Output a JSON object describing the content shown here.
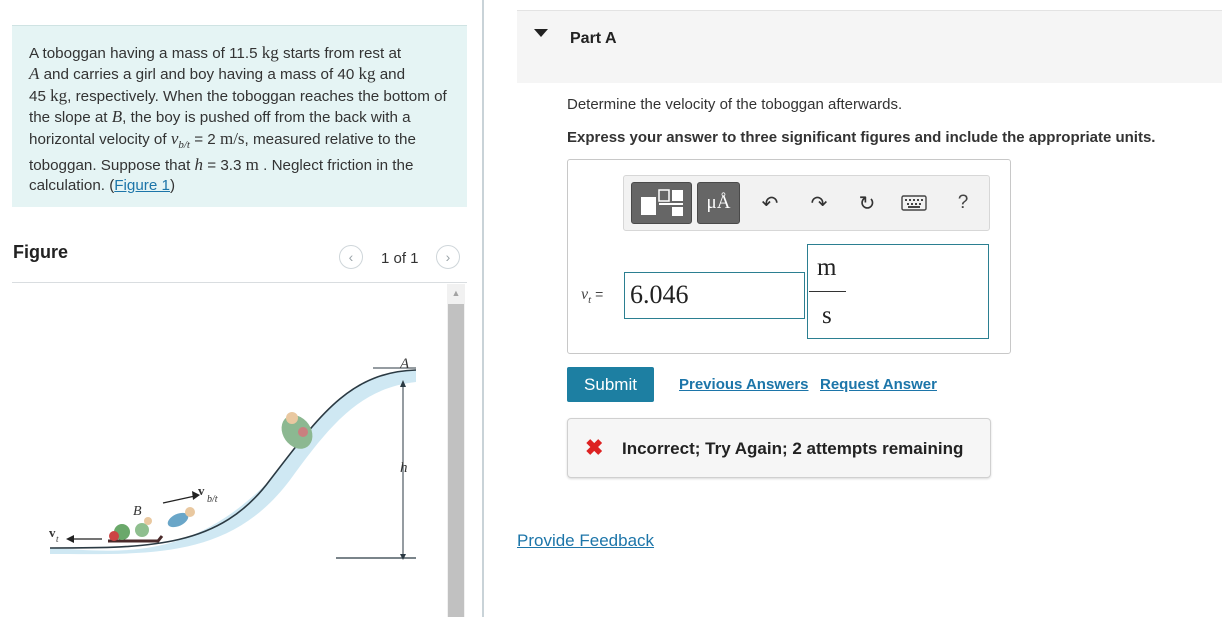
{
  "problem": {
    "seg1": "A toboggan having a mass of 11.5 ",
    "unit_kg": "kg",
    "seg2": " starts from rest at",
    "var_A": "A",
    "seg3": " and carries a girl and boy having a mass of 40 ",
    "seg4": " and",
    "seg5": "45 ",
    "seg6": ", respectively. When the toboggan reaches the bottom of the slope at ",
    "var_B": "B",
    "seg7": ", the boy is pushed off from the back with a horizontal velocity of ",
    "var_v": "v",
    "var_vsub": "b/t",
    "seg8": " = 2 ",
    "unit_ms": "m/s",
    "seg9": ", measured relative to the toboggan. Suppose that ",
    "var_h": "h",
    "seg10": " = 3.3 ",
    "unit_m": "m",
    "seg11": " . Neglect friction in the calculation. (",
    "figure_link": "Figure 1",
    "seg12": ")"
  },
  "figure": {
    "title": "Figure",
    "pager": "1 of 1",
    "prev_icon": "chevron-left-icon",
    "next_icon": "chevron-right-icon",
    "label_A": "A",
    "label_B": "B",
    "label_h": "h",
    "label_vt": "v",
    "label_vt_sub": "t",
    "label_vbt": "v",
    "label_vbt_sub": "b/t"
  },
  "part": {
    "title": "Part A",
    "question": "Determine the velocity of the toboggan afterwards.",
    "instruction": "Express your answer to three significant figures and include the appropriate units."
  },
  "toolbar": {
    "units_label": "μÅ",
    "help_label": "?",
    "icons": [
      "templates-icon",
      "units-icon",
      "undo-icon",
      "redo-icon",
      "reset-icon",
      "keyboard-icon",
      "help-icon"
    ]
  },
  "answer": {
    "var_symbol": "v",
    "var_sub": "t",
    "equals": "=",
    "value": "6.046",
    "unit_num": "m",
    "unit_den": "s"
  },
  "actions": {
    "submit": "Submit",
    "previous": "Previous Answers",
    "request": "Request Answer"
  },
  "feedback": {
    "text": "Incorrect; Try Again; 2 attempts remaining",
    "status_color": "#dd2222"
  },
  "footer": {
    "provide_feedback": "Provide Feedback"
  },
  "colors": {
    "accent": "#1d7fa2",
    "link": "#1c75a9",
    "problem_bg": "#e5f4f4"
  }
}
